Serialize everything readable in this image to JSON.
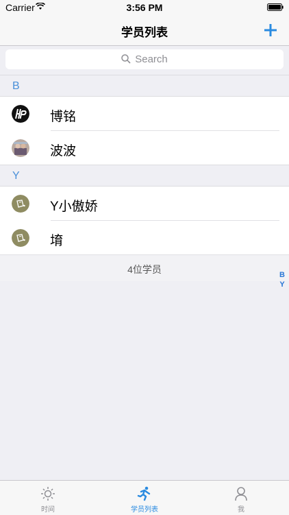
{
  "status_bar": {
    "carrier": "Carrier",
    "time": "3:56 PM"
  },
  "nav": {
    "title": "学员列表",
    "add_icon": "plus-icon"
  },
  "search": {
    "placeholder": "Search"
  },
  "sections": [
    {
      "letter": "B",
      "items": [
        {
          "name": "博铭"
        },
        {
          "name": "波波"
        }
      ]
    },
    {
      "letter": "Y",
      "items": [
        {
          "name": "Y小傲娇"
        },
        {
          "name": "堉"
        }
      ]
    }
  ],
  "footer": {
    "count_text": "4位学员"
  },
  "index": [
    "B",
    "Y"
  ],
  "tabs": [
    {
      "label": "时间",
      "icon": "sun-icon",
      "active": false
    },
    {
      "label": "学员列表",
      "icon": "runner-icon",
      "active": true
    },
    {
      "label": "我",
      "icon": "person-icon",
      "active": false
    }
  ],
  "colors": {
    "accent": "#2a8be0",
    "section_letter": "#4a90d9",
    "background": "#efeff4"
  }
}
